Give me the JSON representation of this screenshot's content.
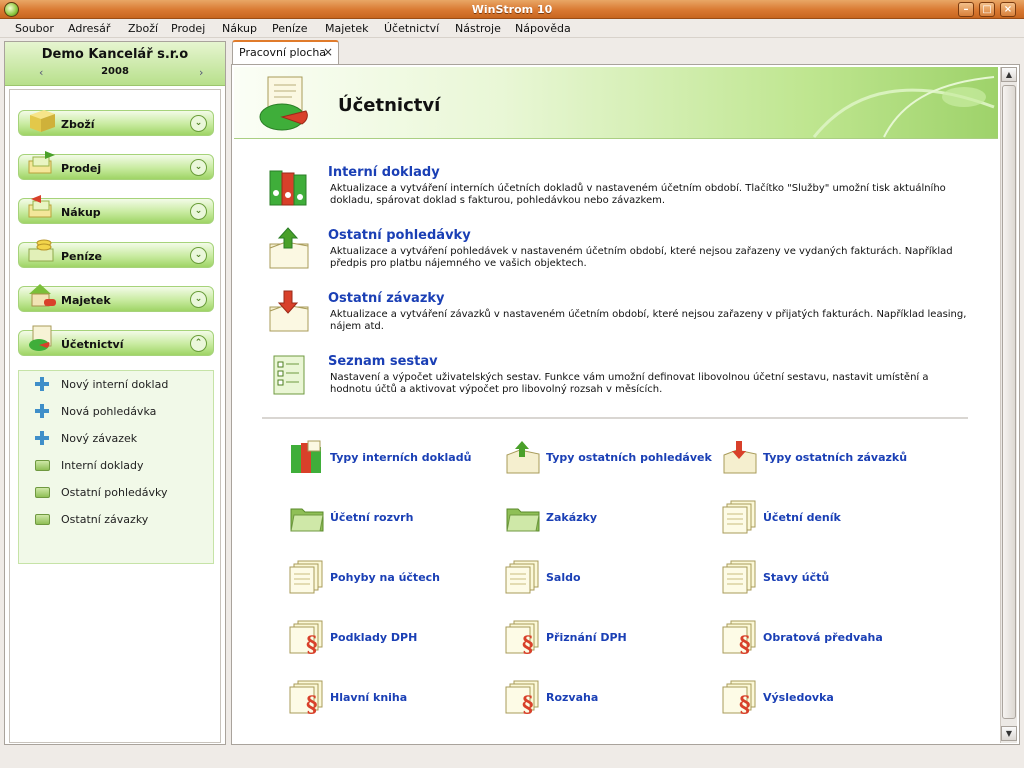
{
  "window": {
    "title": "WinStrom 10"
  },
  "menu": [
    "Soubor",
    "Adresář",
    "Zboží",
    "Prodej",
    "Nákup",
    "Peníze",
    "Majetek",
    "Účetnictví",
    "Nástroje",
    "Nápověda"
  ],
  "company": {
    "name": "Demo Kancelář s.r.o",
    "year": "2008"
  },
  "nav": {
    "categories": [
      "Zboží",
      "Prodej",
      "Nákup",
      "Peníze",
      "Majetek",
      "Účetnictví"
    ],
    "sub_items": [
      "Nový interní doklad",
      "Nová pohledávka",
      "Nový závazek",
      "Interní doklady",
      "Ostatní pohledávky",
      "Ostatní závazky"
    ]
  },
  "tab": {
    "label": "Pracovní plocha",
    "close": "×"
  },
  "banner": {
    "title": "Účetnictví"
  },
  "items": [
    {
      "title": "Interní doklady",
      "desc": "Aktualizace a vytváření interních účetních dokladů v nastaveném účetním období. Tlačítko \"Služby\" umožní tisk aktuálního dokladu, spárovat doklad s fakturou, pohledávkou nebo závazkem."
    },
    {
      "title": "Ostatní pohledávky",
      "desc": "Aktualizace a vytváření pohledávek v nastaveném účetním období, které nejsou zařazeny ve vydaných fakturách. Například předpis pro platbu nájemného ve vašich objektech."
    },
    {
      "title": "Ostatní závazky",
      "desc": "Aktualizace a vytváření závazků v nastaveném účetním období, které nejsou zařazeny v přijatých fakturách. Například leasing, nájem atd."
    },
    {
      "title": "Seznam sestav",
      "desc": "Nastavení a výpočet uživatelských sestav. Funkce vám umožní definovat libovolnou účetní sestavu, nastavit umístění a hodnotu účtů a aktivovat výpočet pro libovolný rozsah v měsících."
    }
  ],
  "links": [
    "Typy interních dokladů",
    "Typy ostatních pohledávek",
    "Typy ostatních závazků",
    "Účetní rozvrh",
    "Zakázky",
    "Účetní deník",
    "Pohyby na účtech",
    "Saldo",
    "Stavy účtů",
    "Podklady DPH",
    "Přiznání DPH",
    "Obratová předvaha",
    "Hlavní kniha",
    "Rozvaha",
    "Výsledovka"
  ]
}
